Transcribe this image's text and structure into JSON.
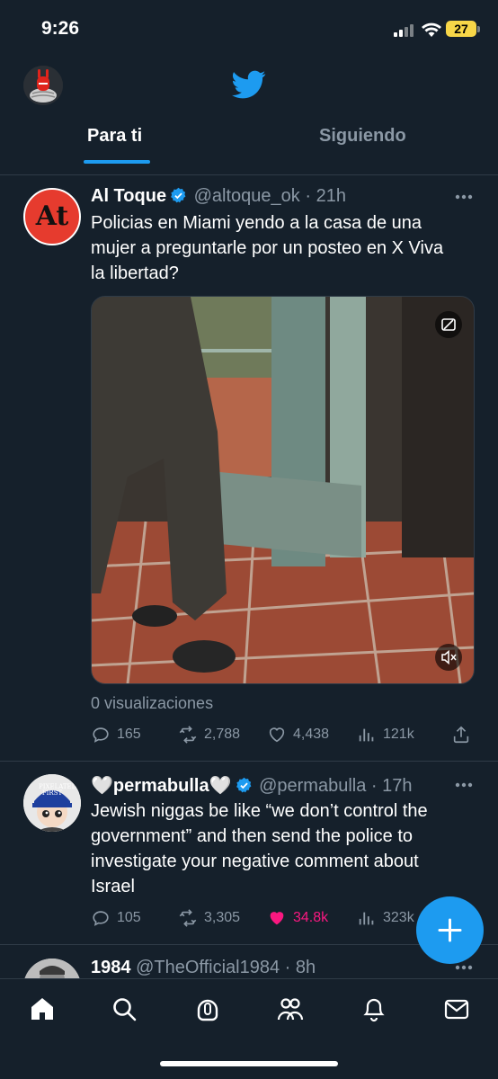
{
  "status_bar": {
    "time": "9:26",
    "battery": "27"
  },
  "header": {
    "tabs": [
      {
        "label": "Para ti",
        "active": true
      },
      {
        "label": "Siguiendo",
        "active": false
      }
    ]
  },
  "tweets": [
    {
      "display_name": "Al Toque",
      "handle": "@altoque_ok",
      "time": "21h",
      "avatar_text": "At",
      "text": "Policias en Miami yendo a la casa de una mujer a preguntarle por un posteo en X Viva la libertad?",
      "views": "0 visualizaciones",
      "replies": "165",
      "retweets": "2,788",
      "likes": "4,438",
      "impressions": "121k"
    },
    {
      "display_name": "🤍permabulla🤍",
      "handle": "@permabulla",
      "time": "17h",
      "avatar_cap_text": "PIXELATED FIRST",
      "text": "Jewish niggas be like “we don’t control the government” and then send the police to investigate your negative comment about Israel",
      "replies": "105",
      "retweets": "3,305",
      "likes": "34.8k",
      "likes_color": "#f91880",
      "impressions": "323k"
    },
    {
      "display_name": "1984",
      "handle": "@TheOfficial1984",
      "time": "8h"
    }
  ],
  "colors": {
    "accent": "#1d9bf0",
    "background": "#15202b",
    "like": "#f91880"
  },
  "icons": {
    "nav": [
      "home-icon",
      "search-icon",
      "spaces-icon",
      "communities-icon",
      "notifications-icon",
      "messages-icon"
    ],
    "compose": "plus-icon"
  }
}
